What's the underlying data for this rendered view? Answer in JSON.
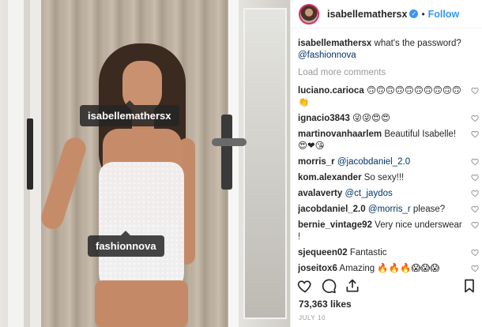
{
  "post": {
    "username": "isabellemathersx",
    "verified_symbol": "✓",
    "dot": "•",
    "follow_label": "Follow",
    "photo_tags": [
      "isabellemathersx",
      "fashionnova"
    ],
    "caption": {
      "user": "isabellemathersx",
      "text": "what's the password?",
      "mention": "@fashionnova"
    },
    "load_more": "Load more comments",
    "comments": [
      {
        "user": "luciano.carioca",
        "text": "🙃🙃🙃🙃🙃🙃🙃🙃🙃🙃👏"
      },
      {
        "user": "ignacio3843",
        "text": "😜😜😍😍"
      },
      {
        "user": "martinovanhaarlem",
        "text": "Beautiful Isabelle! 😍❤😘"
      },
      {
        "user": "morris_r",
        "text": "",
        "mention": "@jacobdaniel_2.0"
      },
      {
        "user": "kom.alexander",
        "text": "So sexy!!!"
      },
      {
        "user": "avalaverty",
        "text": "",
        "mention": "@ct_jaydos"
      },
      {
        "user": "jacobdaniel_2.0",
        "text": "please?",
        "mention": "@morris_r"
      },
      {
        "user": "bernie_vintage92",
        "text": "Very nice underswear !"
      },
      {
        "user": "sjequeen02",
        "text": "Fantastic"
      },
      {
        "user": "joseitox6",
        "text": "Amazing 🔥🔥🔥😱😱😱"
      }
    ],
    "likes": "73,363 likes",
    "date": "JULY 10"
  },
  "icons": {
    "heart": "heart-icon",
    "comment": "comment-icon",
    "share": "share-icon",
    "bookmark": "bookmark-icon"
  },
  "colors": {
    "link": "#003569",
    "follow": "#3897f0",
    "muted": "#999999"
  }
}
